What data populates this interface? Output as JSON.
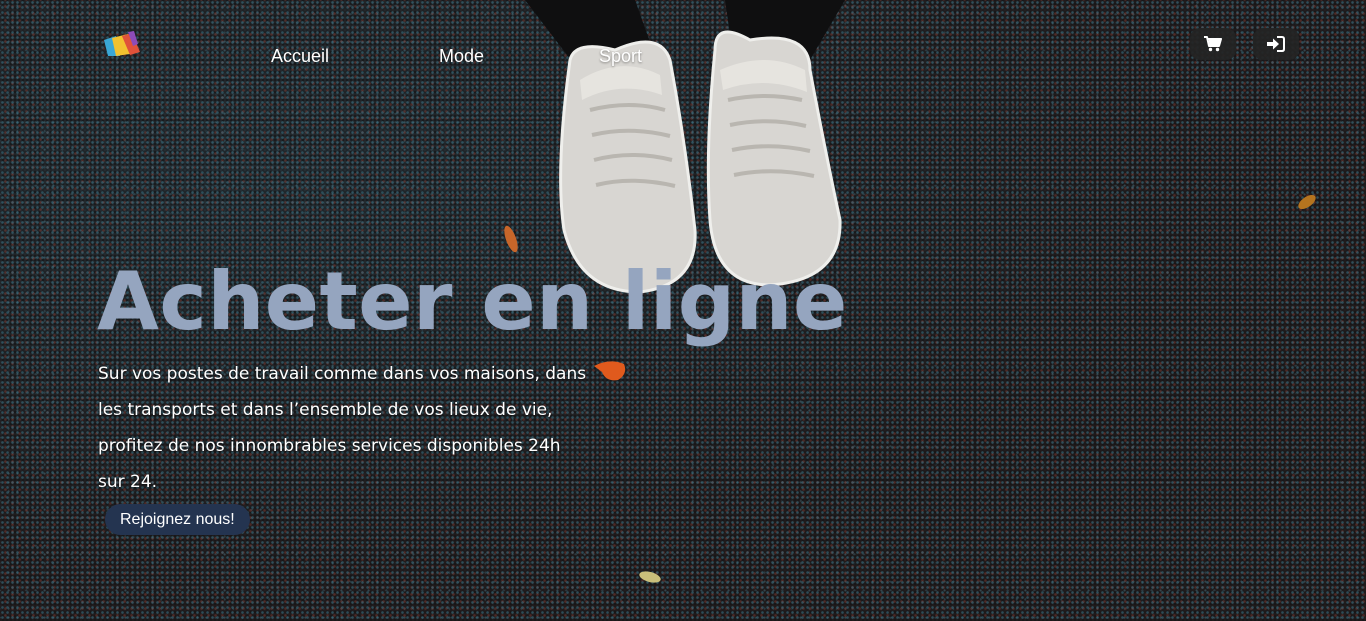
{
  "nav": {
    "links": [
      {
        "label": "Accueil"
      },
      {
        "label": "Mode"
      },
      {
        "label": "Sport"
      }
    ],
    "logo_icon": "shopping-bags-logo",
    "cart_icon": "cart-icon",
    "login_icon": "sign-in-icon"
  },
  "hero": {
    "title": "Acheter en ligne",
    "text": "Sur vos postes de travail comme dans vos maisons, dans les transports et dans l’ensemble de vos lieux de vie, profitez de nos innombrables services disponibles 24h sur 24.",
    "cta_label": "Rejoignez nous!"
  },
  "colors": {
    "title": "#95a5bf",
    "cta_background": "#243450",
    "icon_button_background": "#242424",
    "background": "#221d1e"
  }
}
